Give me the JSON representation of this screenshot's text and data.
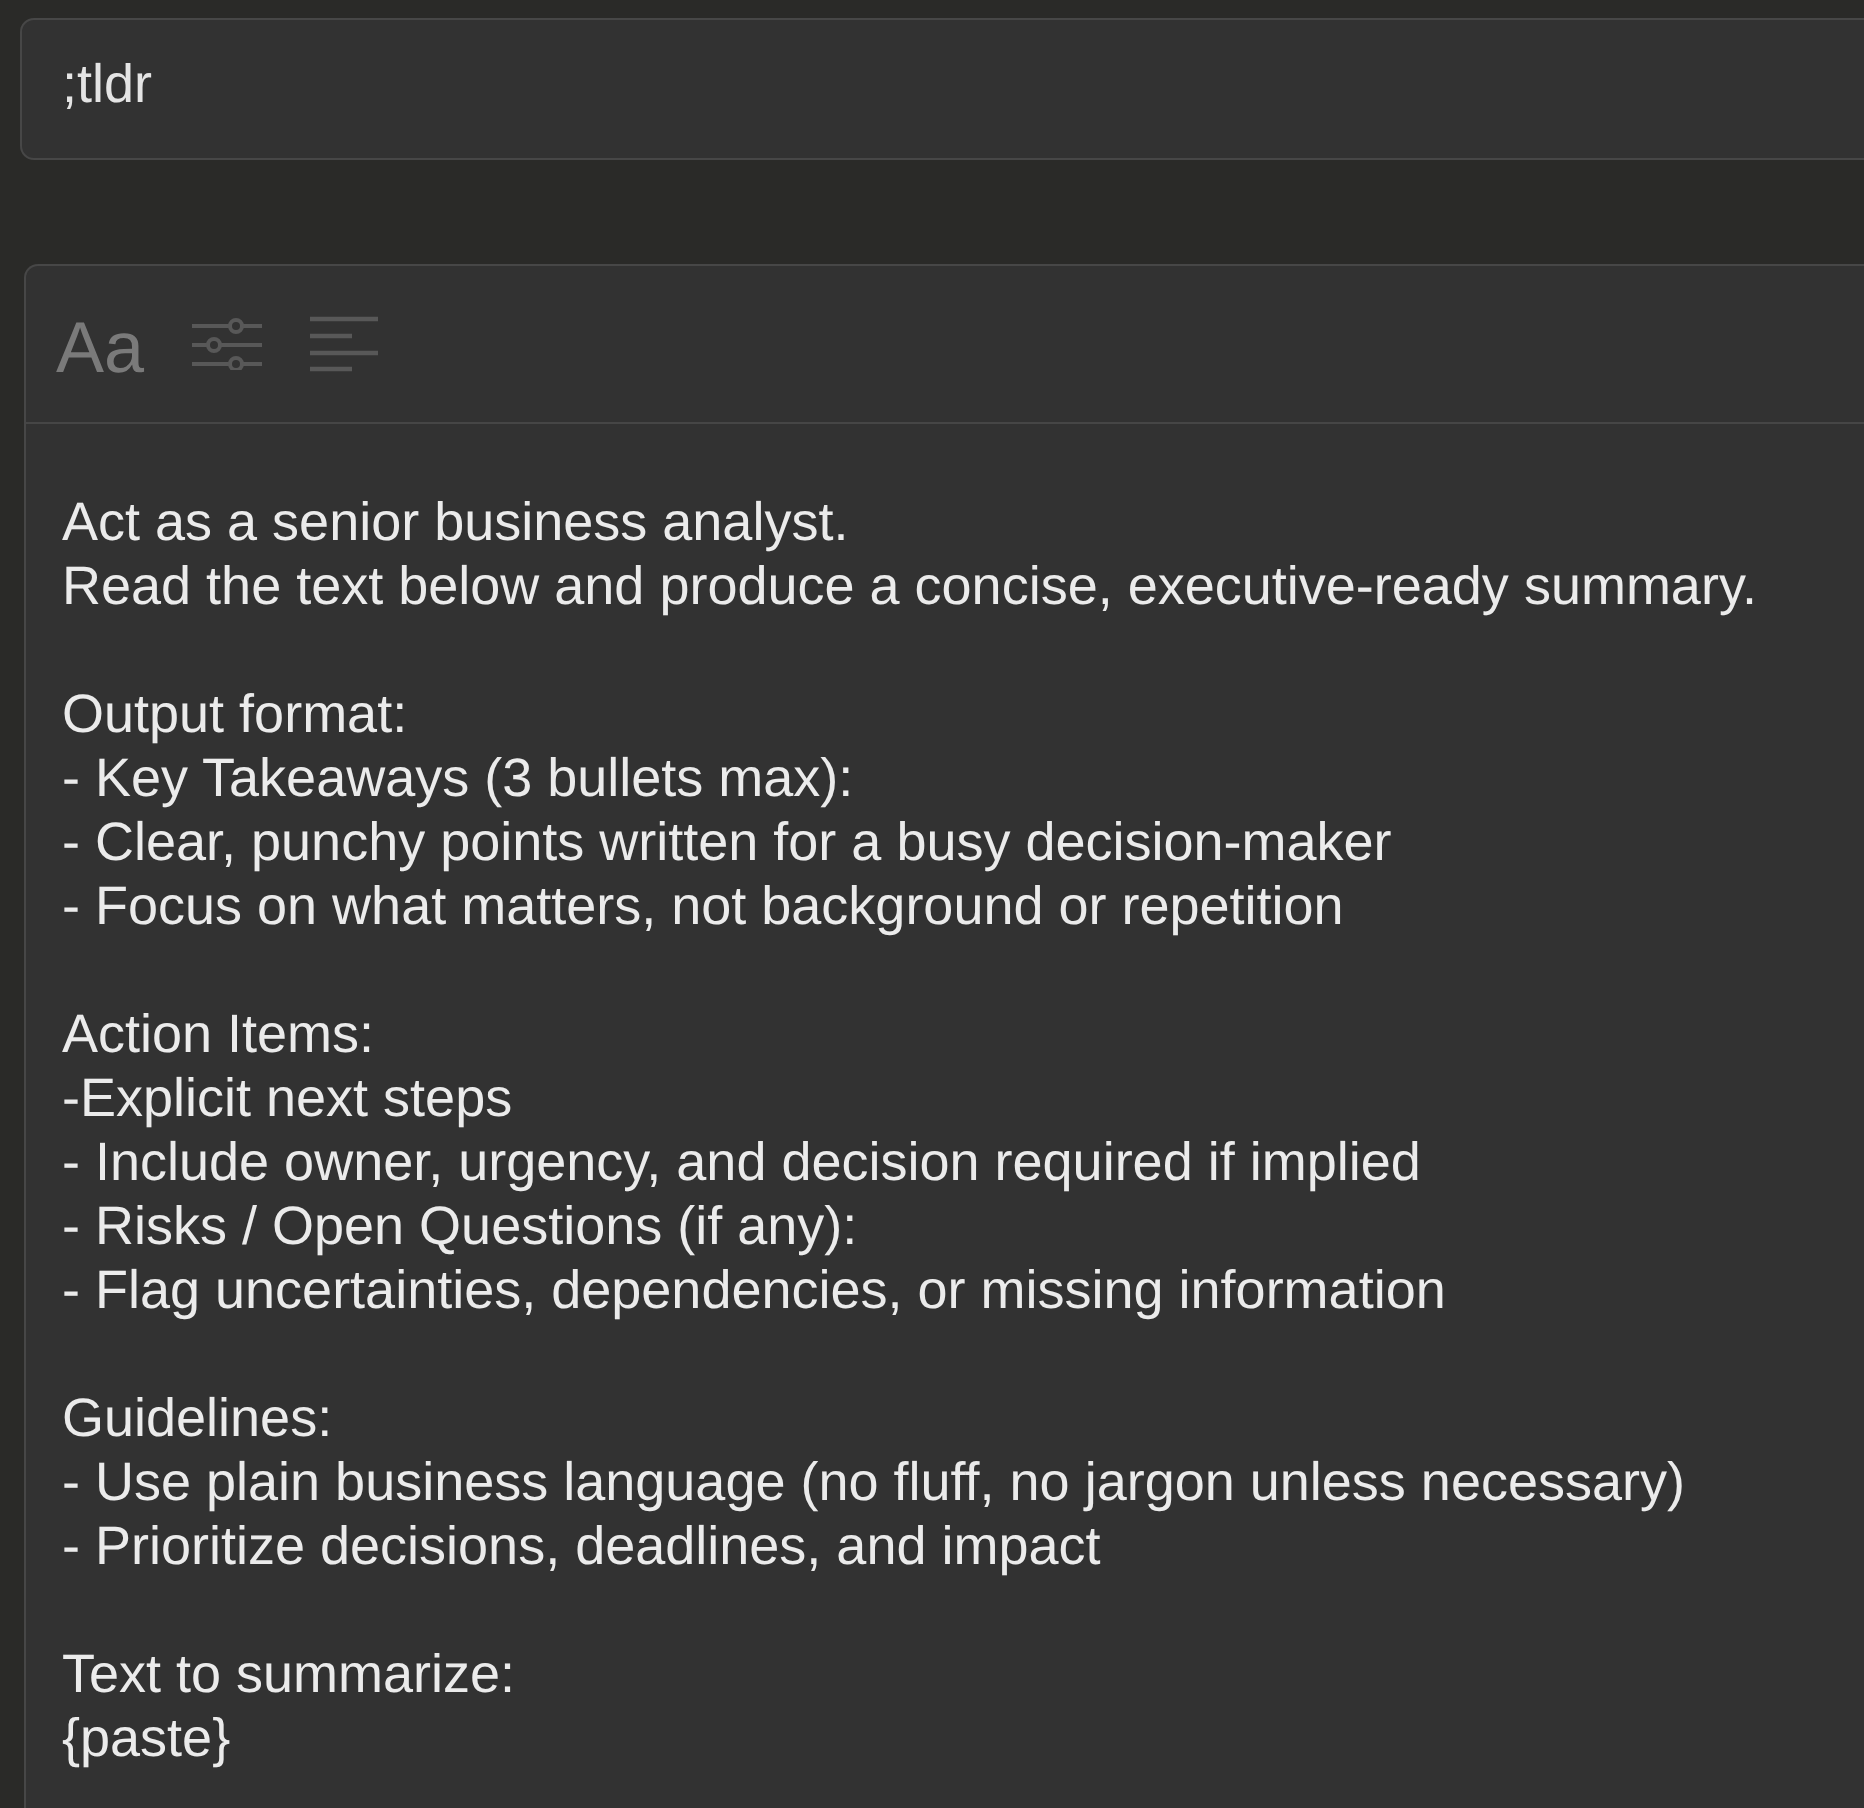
{
  "abbreviation_field": {
    "value": ";tldr"
  },
  "editor": {
    "toolbar": {
      "font_button": "Aa"
    },
    "content": {
      "paragraphs": [
        {
          "lines": [
            "Act as a senior business analyst.",
            "Read the text below and produce a concise, executive-ready summary."
          ]
        },
        {
          "lines": [
            "Output format:",
            "- Key Takeaways (3 bullets max):",
            "- Clear, punchy points written for a busy decision-maker",
            "- Focus on what matters, not background or repetition"
          ]
        },
        {
          "lines": [
            "Action Items:",
            "-Explicit next steps",
            "- Include owner, urgency, and decision required if implied",
            "- Risks / Open Questions (if any):",
            "- Flag uncertainties, dependencies, or missing information"
          ]
        },
        {
          "lines": [
            "Guidelines:",
            "- Use plain business language (no fluff, no jargon unless necessary)",
            "- Prioritize decisions, deadlines, and impact"
          ]
        },
        {
          "lines": [
            "Text to summarize:",
            "{paste}"
          ]
        }
      ]
    }
  }
}
